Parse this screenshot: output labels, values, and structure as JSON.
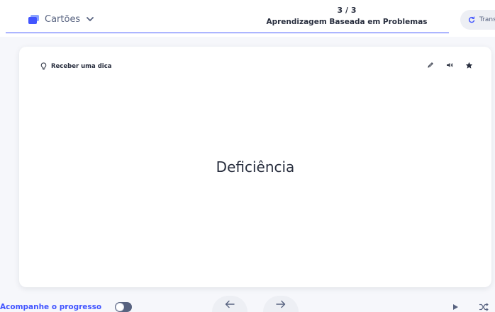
{
  "header": {
    "mode_label": "Cartões",
    "progress_count": "3 / 3",
    "set_title": "Aprendizagem Baseada em Problemas",
    "transcribe_label": "Trans"
  },
  "card": {
    "hint_label": "Receber uma dica",
    "term": "Deficiência",
    "tools": [
      "pencil-icon",
      "speaker-icon",
      "star-icon"
    ]
  },
  "footer": {
    "track_progress_label": "Acompanhe o progresso",
    "track_progress_on": false,
    "prev_icon": "arrow-left-icon",
    "next_icon": "arrow-right-icon",
    "play_icon": "play-icon",
    "shuffle_icon": "shuffle-icon"
  },
  "colors": {
    "accent": "#4255ff",
    "text": "#282e3e",
    "muted": "#586380",
    "background": "#f6f7fb"
  }
}
